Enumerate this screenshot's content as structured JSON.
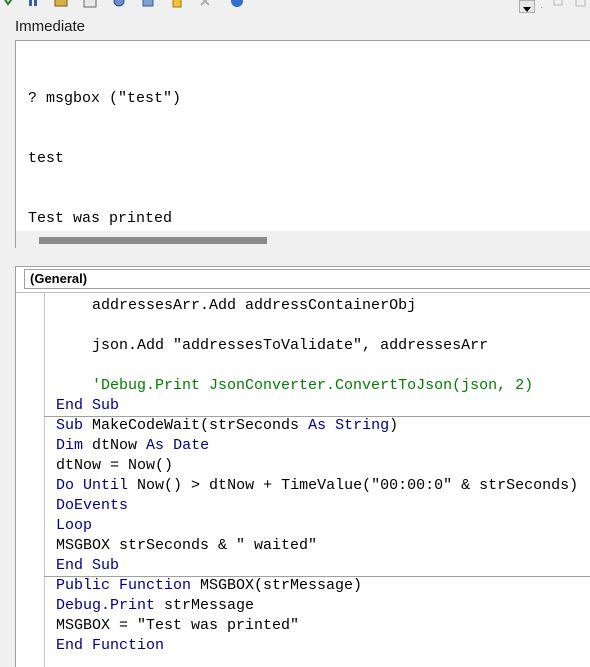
{
  "toolbar": {
    "icons": [
      "run-icon",
      "step-icon",
      "module-icon",
      "object-browser-icon",
      "properties-icon",
      "toolbox-icon",
      "close-icon",
      "help-icon"
    ]
  },
  "immediate": {
    "title": "Immediate",
    "lines": [
      "? msgbox (\"test\")",
      "test",
      "Test was printed"
    ]
  },
  "code": {
    "object_dropdown": "(General)",
    "lines": [
      {
        "indent": "    ",
        "parts": [
          {
            "t": "addressesArr.Add addressContainerObj",
            "c": "plain"
          }
        ]
      },
      {
        "indent": "",
        "parts": []
      },
      {
        "indent": "    ",
        "parts": [
          {
            "t": "json.Add \"addressesToValidate\", addressesArr",
            "c": "plain"
          }
        ]
      },
      {
        "indent": "",
        "parts": []
      },
      {
        "indent": "    ",
        "parts": [
          {
            "t": "'Debug.Print JsonConverter.ConvertToJson(json, 2)",
            "c": "comment"
          }
        ]
      },
      {
        "indent": "",
        "parts": [
          {
            "t": "End Sub",
            "c": "kw"
          }
        ]
      },
      {
        "indent": "",
        "parts": [
          {
            "t": "Sub",
            "c": "kw"
          },
          {
            "t": " MakeCodeWait(strSeconds ",
            "c": "plain"
          },
          {
            "t": "As",
            "c": "kw"
          },
          {
            "t": " ",
            "c": "plain"
          },
          {
            "t": "String",
            "c": "kw"
          },
          {
            "t": ")",
            "c": "plain"
          }
        ]
      },
      {
        "indent": "",
        "parts": [
          {
            "t": "Dim",
            "c": "kw"
          },
          {
            "t": " dtNow ",
            "c": "plain"
          },
          {
            "t": "As",
            "c": "kw"
          },
          {
            "t": " ",
            "c": "plain"
          },
          {
            "t": "Date",
            "c": "kw"
          }
        ]
      },
      {
        "indent": "",
        "parts": [
          {
            "t": "dtNow = Now()",
            "c": "plain"
          }
        ]
      },
      {
        "indent": "",
        "parts": [
          {
            "t": "Do",
            "c": "kw"
          },
          {
            "t": " ",
            "c": "plain"
          },
          {
            "t": "Until",
            "c": "kw"
          },
          {
            "t": " Now() > dtNow + TimeValue(\"00:00:0\" & strSeconds)",
            "c": "plain"
          }
        ]
      },
      {
        "indent": "",
        "parts": [
          {
            "t": "DoEvents",
            "c": "kw"
          }
        ]
      },
      {
        "indent": "",
        "parts": [
          {
            "t": "Loop",
            "c": "kw"
          }
        ]
      },
      {
        "indent": "",
        "parts": [
          {
            "t": "MSGBOX strSeconds & \" waited\"",
            "c": "plain"
          }
        ]
      },
      {
        "indent": "",
        "parts": [
          {
            "t": "End Sub",
            "c": "kw"
          }
        ]
      },
      {
        "indent": "",
        "parts": [
          {
            "t": "Public Function",
            "c": "kw"
          },
          {
            "t": " MSGBOX(strMessage)",
            "c": "plain"
          }
        ]
      },
      {
        "indent": "",
        "parts": [
          {
            "t": "Debug.Print",
            "c": "kw"
          },
          {
            "t": " strMessage",
            "c": "plain"
          }
        ]
      },
      {
        "indent": "",
        "parts": [
          {
            "t": "MSGBOX = \"Test was printed\"",
            "c": "plain"
          }
        ]
      },
      {
        "indent": "",
        "parts": [
          {
            "t": "End Function",
            "c": "kw"
          }
        ]
      }
    ],
    "procedure_separator_after": [
      5,
      13
    ]
  },
  "colors": {
    "keyword": "#00008b",
    "comment": "#008000",
    "plain": "#000000"
  }
}
